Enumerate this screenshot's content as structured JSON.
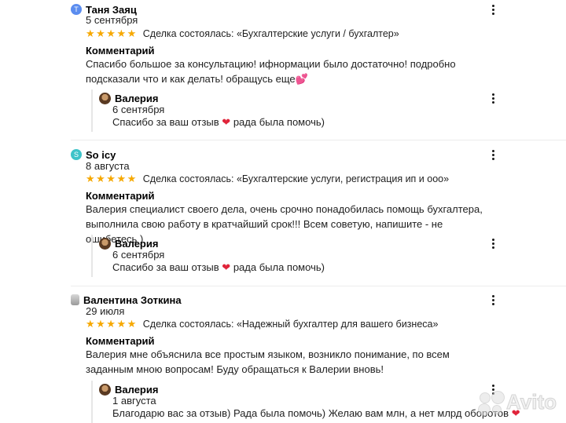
{
  "reviews": [
    {
      "avatar_letter": "T",
      "author": "Таня Заяц",
      "date": "5 сентября",
      "stars": "★★★★★",
      "deal": "Сделка состоялась: «Бухгалтерские услуги / бухгалтер»",
      "comment_label": "Комментарий",
      "comment": "Спасибо большое за консультацию! ифнормации было достаточно! подробно подсказали что и как делать! обращусь еще",
      "comment_emoji": "💕",
      "reply": {
        "author": "Валерия",
        "date": "6 сентября",
        "text_before": "Спасибо за ваш отзыв",
        "heart": "❤",
        "text_after": "рада была помочь)"
      }
    },
    {
      "avatar_letter": "S",
      "author": "So icy",
      "date": "8 августа",
      "stars": "★★★★★",
      "deal": "Сделка состоялась: «Бухгалтерские услуги, регистрация ип и ооо»",
      "comment_label": "Комментарий",
      "comment": "Валерия специалист своего дела, очень срочно понадобилась помощь бухгалтера, выполнила свою работу в кратчайший срок!!! Всем советую, напишите - не ошибетесь )",
      "reply": {
        "author": "Валерия",
        "date": "6 сентября",
        "text_before": "Спасибо за ваш отзыв",
        "heart": "❤",
        "text_after": "рада была помочь)"
      }
    },
    {
      "author": "Валентина Зоткина",
      "date": "29 июля",
      "stars": "★★★★★",
      "deal": "Сделка состоялась: «Надежный бухгалтер для вашего бизнеса»",
      "comment_label": "Комментарий",
      "comment": "Валерия мне объяснила все простым языком, возникло понимание, по всем заданным мною вопросам! Буду обращаться к Валерии вновь!",
      "reply": {
        "author": "Валерия",
        "date": "1 августа",
        "text_before": "Благодарю вас за отзыв) Рада была помочь) Желаю вам млн, а нет млрд оборотов",
        "heart": "❤",
        "text_after": ""
      }
    }
  ],
  "watermark": "Avito",
  "colors": {
    "stars": "#f6a800",
    "heart": "#e0243a",
    "avatar_t": "#5b8def",
    "avatar_s": "#3fc3c9"
  }
}
